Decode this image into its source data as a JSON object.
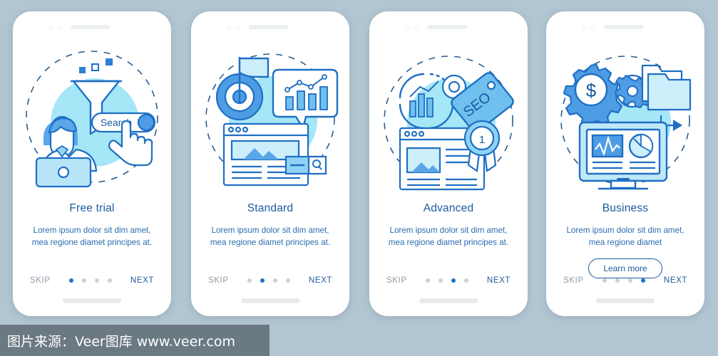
{
  "background_color": "#b2c6d2",
  "accent_color": "#1f6fc4",
  "title_color": "#1b5a9e",
  "cards": [
    {
      "title": "Free trial",
      "description": "Lorem ipsum dolor sit dim amet, mea regione diamet principes at.",
      "skip_label": "SKIP",
      "next_label": "NEXT",
      "active_dot": 1,
      "dot_count": 4,
      "illustration": "search-funnel-person",
      "search_label": "Search",
      "cta_label": ""
    },
    {
      "title": "Standard",
      "description": "Lorem ipsum dolor sit dim amet, mea regione diamet principes at.",
      "skip_label": "SKIP",
      "next_label": "NEXT",
      "active_dot": 2,
      "dot_count": 4,
      "illustration": "target-flag-chart-browser",
      "cta_label": ""
    },
    {
      "title": "Advanced",
      "description": "Lorem ipsum dolor sit dim amet, mea regione diamet principes at.",
      "skip_label": "SKIP",
      "next_label": "NEXT",
      "active_dot": 3,
      "dot_count": 4,
      "illustration": "seo-tag-award-browser",
      "seo_label": "SEO",
      "award_number": "1",
      "cta_label": ""
    },
    {
      "title": "Business",
      "description": "Lorem ipsum dolor sit dim amet, mea regione diamet",
      "skip_label": "SKIP",
      "next_label": "NEXT",
      "active_dot": 4,
      "dot_count": 4,
      "illustration": "gear-dollar-folder-monitor",
      "cta_label": "Learn more"
    }
  ],
  "watermark": {
    "text": "图片来源：Veer图库 www.veer.com"
  }
}
